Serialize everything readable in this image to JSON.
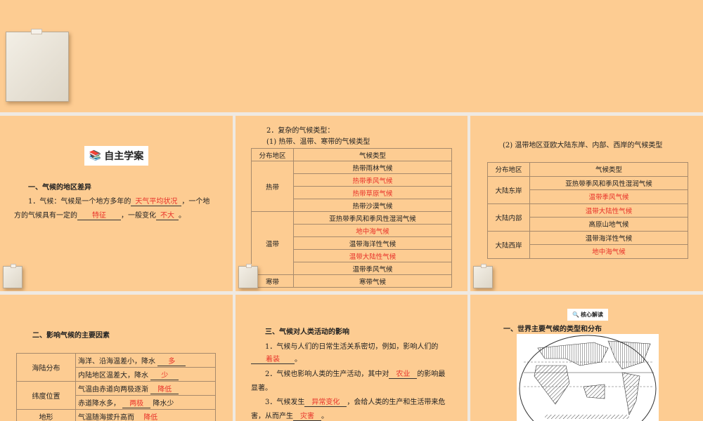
{
  "panel1": {
    "badge": "自主学案",
    "heading": "一、气候的地区差异",
    "p1_a": "1．气候：气候是一个地方多年的",
    "p1_b1": "天气平均状况",
    "p1_c": "，一个地",
    "p1_d": "方的气候具有一定的",
    "p1_b2": "特征",
    "p1_e": "，一般变化",
    "p1_b3": "不大",
    "p1_f": "。"
  },
  "panel2": {
    "line1": "2．复杂的气候类型：",
    "line2": "(1) 热带、温带、寒带的气候类型",
    "headers": [
      "分布地区",
      "气候类型"
    ],
    "groups": [
      {
        "zone": "热带",
        "types": [
          {
            "t": "热带雨林气候",
            "red": false
          },
          {
            "t": "热带季风气候",
            "red": true
          },
          {
            "t": "热带草原气候",
            "red": true
          },
          {
            "t": "热带沙漠气候",
            "red": false
          }
        ]
      },
      {
        "zone": "温带",
        "types": [
          {
            "t": "亚热带季风和季风性湿润气候",
            "red": false
          },
          {
            "t": "地中海气候",
            "red": true
          },
          {
            "t": "温带海洋性气候",
            "red": false
          },
          {
            "t": "温带大陆性气候",
            "red": true
          },
          {
            "t": "温带季风气候",
            "red": false
          }
        ]
      },
      {
        "zone": "寒带",
        "types": [
          {
            "t": "寒带气候",
            "red": false
          }
        ]
      }
    ]
  },
  "panel3": {
    "title": "(2) 温带地区亚欧大陆东岸、内部、西岸的气候类型",
    "headers": [
      "分布地区",
      "气候类型"
    ],
    "groups": [
      {
        "zone": "大陆东岸",
        "types": [
          {
            "t": "亚热带季风和季风性湿润气候",
            "red": false
          },
          {
            "t": "温带季风气候",
            "red": true
          }
        ]
      },
      {
        "zone": "大陆内部",
        "types": [
          {
            "t": "温带大陆性气候",
            "red": true
          },
          {
            "t": "高原山地气候",
            "red": false
          }
        ]
      },
      {
        "zone": "大陆西岸",
        "types": [
          {
            "t": "温带海洋性气候",
            "red": false
          },
          {
            "t": "地中海气候",
            "red": true
          }
        ]
      }
    ]
  },
  "panel4": {
    "heading": "二、影响气候的主要因素",
    "rows": [
      {
        "factor": "海陆分布",
        "a": "海洋、沿海温差小，降水",
        "b": "多",
        "c": ""
      },
      {
        "factor": "",
        "a": "内陆地区温差大，降水",
        "b": "少",
        "c": ""
      },
      {
        "factor": "纬度位置",
        "a": "气温由赤道向两极逐渐",
        "b": "降低",
        "c": ""
      },
      {
        "factor": "",
        "a": "赤道降水多，",
        "b": "两极",
        "c": "降水少"
      },
      {
        "factor": "地形",
        "a": "气温随海拔升高而",
        "b": "降低",
        "c": ""
      }
    ]
  },
  "panel5": {
    "heading": "三、气候对人类活动的影响",
    "p1a": "1．气候与人们的日常生活关系密切，例如，影响人们的",
    "p1b": "着装",
    "p1c": "。",
    "p2a": "2．气候也影响人类的生产活动，其中对",
    "p2b": "农业",
    "p2c": "的影响最",
    "p2d": "显著。",
    "p3a": "3．气候发生",
    "p3b": "异常变化",
    "p3c": "，会给人类的生产和生活带来危",
    "p3d": "害，从而产生",
    "p3e": "灾害",
    "p3f": "。"
  },
  "panel6": {
    "badge": "核心解读",
    "heading": "一、世界主要气候的类型和分布"
  }
}
